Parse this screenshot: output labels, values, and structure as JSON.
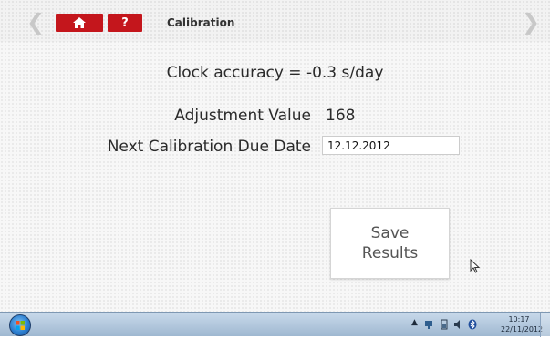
{
  "header": {
    "title": "Calibration",
    "help_label": "?",
    "back_icon": "chevron-left-icon",
    "forward_icon": "chevron-right-icon",
    "home_icon": "home-icon",
    "accent_color": "#c4161c"
  },
  "main": {
    "accuracy_text": "Clock accuracy = -0.3 s/day",
    "adjustment_label": "Adjustment Value",
    "adjustment_value": "168",
    "due_date_label": "Next Calibration Due Date",
    "due_date_value": "12.12.2012",
    "save_line1": "Save",
    "save_line2": "Results"
  },
  "taskbar": {
    "time": "10:17",
    "date": "22/11/2012",
    "tray_up_arrow": "▲"
  }
}
